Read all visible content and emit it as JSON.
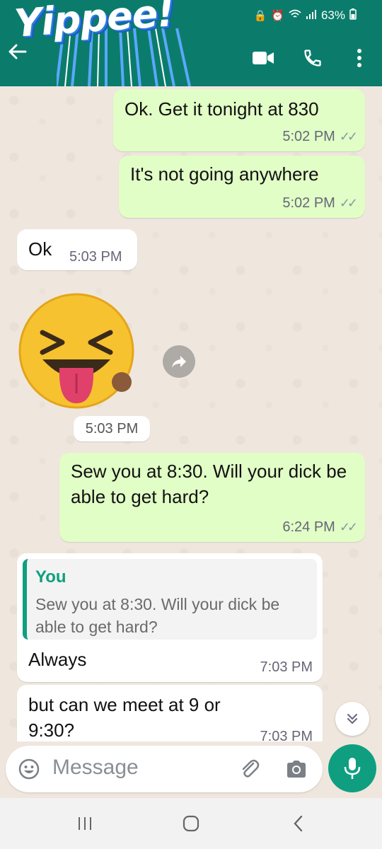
{
  "status": {
    "battery": "63%"
  },
  "header": {
    "sticker_text": "Yippee!"
  },
  "messages": [
    {
      "dir": "out",
      "text": "Ok. Get it tonight at 830",
      "time": "5:02 PM"
    },
    {
      "dir": "out",
      "text": "It's not going anywhere",
      "time": "5:02 PM"
    },
    {
      "dir": "in",
      "text": "Ok",
      "time": "5:03 PM"
    },
    {
      "dir": "in",
      "type": "sticker",
      "time": "5:03 PM"
    },
    {
      "dir": "out",
      "text": "Sew you at 8:30. Will your dick be able to get hard?",
      "time": "6:24 PM"
    },
    {
      "dir": "in",
      "quote_author": "You",
      "quote_text": "Sew you at 8:30. Will your dick be able to get hard?",
      "text": "Always",
      "time": "7:03 PM"
    },
    {
      "dir": "in",
      "text": "but can we meet at 9 or 9:30?",
      "time": "7:03 PM"
    }
  ],
  "composer": {
    "placeholder": "Message"
  },
  "colors": {
    "header": "#0b7c6b",
    "outgoing": "#e1fec6",
    "incoming": "#ffffff",
    "accent": "#0f9f80"
  },
  "icons": [
    "back-arrow-icon",
    "video-call-icon",
    "phone-icon",
    "more-vert-icon",
    "forward-icon",
    "chevron-down-icon",
    "emoji-icon",
    "attach-icon",
    "camera-icon",
    "mic-icon",
    "recents-icon",
    "home-icon",
    "back-nav-icon"
  ]
}
